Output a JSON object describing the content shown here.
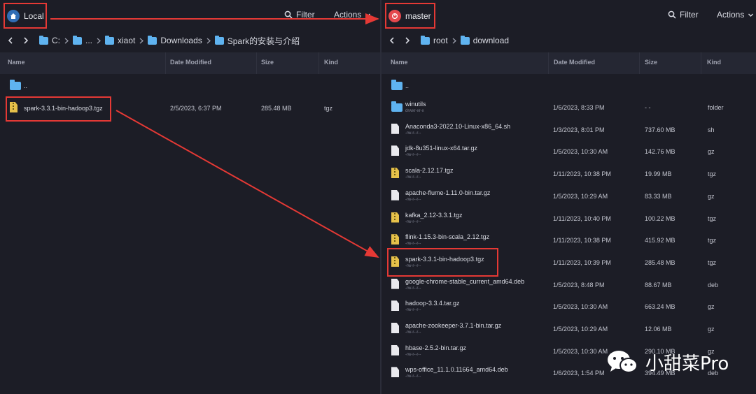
{
  "left": {
    "host_label": "Local",
    "filter_label": "Filter",
    "actions_label": "Actions",
    "breadcrumb": [
      "C:",
      "...",
      "xiaot",
      "Downloads",
      "Spark的安装与介绍"
    ],
    "columns": {
      "name": "Name",
      "date": "Date Modified",
      "size": "Size",
      "kind": "Kind"
    },
    "parent_label": "..",
    "files": [
      {
        "name": "spark-3.3.1-bin-hadoop3.tgz",
        "date": "2/5/2023, 6:37 PM",
        "size": "285.48 MB",
        "kind": "tgz",
        "icon": "archive-icon"
      }
    ]
  },
  "right": {
    "host_label": "master",
    "filter_label": "Filter",
    "actions_label": "Actions",
    "breadcrumb": [
      "root",
      "download"
    ],
    "columns": {
      "name": "Name",
      "date": "Date Modified",
      "size": "Size",
      "kind": "Kind"
    },
    "parent_label": "..",
    "files": [
      {
        "name": "winutils",
        "perm": "drwxr-xr-x",
        "date": "1/6/2023, 8:33 PM",
        "size": "- -",
        "kind": "folder",
        "icon": "folder-icon"
      },
      {
        "name": "Anaconda3-2022.10-Linux-x86_64.sh",
        "perm": "-rw-r--r--",
        "date": "1/3/2023, 8:01 PM",
        "size": "737.60 MB",
        "kind": "sh",
        "icon": "file-icon"
      },
      {
        "name": "jdk-8u351-linux-x64.tar.gz",
        "perm": "-rw-r--r--",
        "date": "1/5/2023, 10:30 AM",
        "size": "142.76 MB",
        "kind": "gz",
        "icon": "file-icon"
      },
      {
        "name": "scala-2.12.17.tgz",
        "perm": "-rw-r--r--",
        "date": "1/11/2023, 10:38 PM",
        "size": "19.99 MB",
        "kind": "tgz",
        "icon": "archive-icon"
      },
      {
        "name": "apache-flume-1.11.0-bin.tar.gz",
        "perm": "-rw-r--r--",
        "date": "1/5/2023, 10:29 AM",
        "size": "83.33 MB",
        "kind": "gz",
        "icon": "file-icon"
      },
      {
        "name": "kafka_2.12-3.3.1.tgz",
        "perm": "-rw-r--r--",
        "date": "1/11/2023, 10:40 PM",
        "size": "100.22 MB",
        "kind": "tgz",
        "icon": "archive-icon"
      },
      {
        "name": "flink-1.15.3-bin-scala_2.12.tgz",
        "perm": "-rw-r--r--",
        "date": "1/11/2023, 10:38 PM",
        "size": "415.92 MB",
        "kind": "tgz",
        "icon": "archive-icon"
      },
      {
        "name": "spark-3.3.1-bin-hadoop3.tgz",
        "perm": "-rw-r--r--",
        "date": "1/11/2023, 10:39 PM",
        "size": "285.48 MB",
        "kind": "tgz",
        "icon": "archive-icon"
      },
      {
        "name": "google-chrome-stable_current_amd64.deb",
        "perm": "-rw-r--r--",
        "date": "1/5/2023, 8:48 PM",
        "size": "88.67 MB",
        "kind": "deb",
        "icon": "file-icon"
      },
      {
        "name": "hadoop-3.3.4.tar.gz",
        "perm": "-rw-r--r--",
        "date": "1/5/2023, 10:30 AM",
        "size": "663.24 MB",
        "kind": "gz",
        "icon": "file-icon"
      },
      {
        "name": "apache-zookeeper-3.7.1-bin.tar.gz",
        "perm": "-rw-r--r--",
        "date": "1/5/2023, 10:29 AM",
        "size": "12.06 MB",
        "kind": "gz",
        "icon": "file-icon"
      },
      {
        "name": "hbase-2.5.2-bin.tar.gz",
        "perm": "-rw-r--r--",
        "date": "1/5/2023, 10:30 AM",
        "size": "290.10 MB",
        "kind": "gz",
        "icon": "file-icon"
      },
      {
        "name": "wps-office_11.1.0.11664_amd64.deb",
        "perm": "-rw-r--r--",
        "date": "1/6/2023, 1:54 PM",
        "size": "394.49 MB",
        "kind": "deb",
        "icon": "file-icon"
      }
    ]
  },
  "watermark": {
    "text": "小甜菜Pro",
    "icon": "wechat-icon"
  },
  "colors": {
    "background": "#1c1d26",
    "header": "#252733",
    "folder": "#5fb3f0",
    "archive": "#e6c14a",
    "highlight": "#e53935",
    "local_host": "#2f6db5",
    "master_host": "#e5484d"
  }
}
